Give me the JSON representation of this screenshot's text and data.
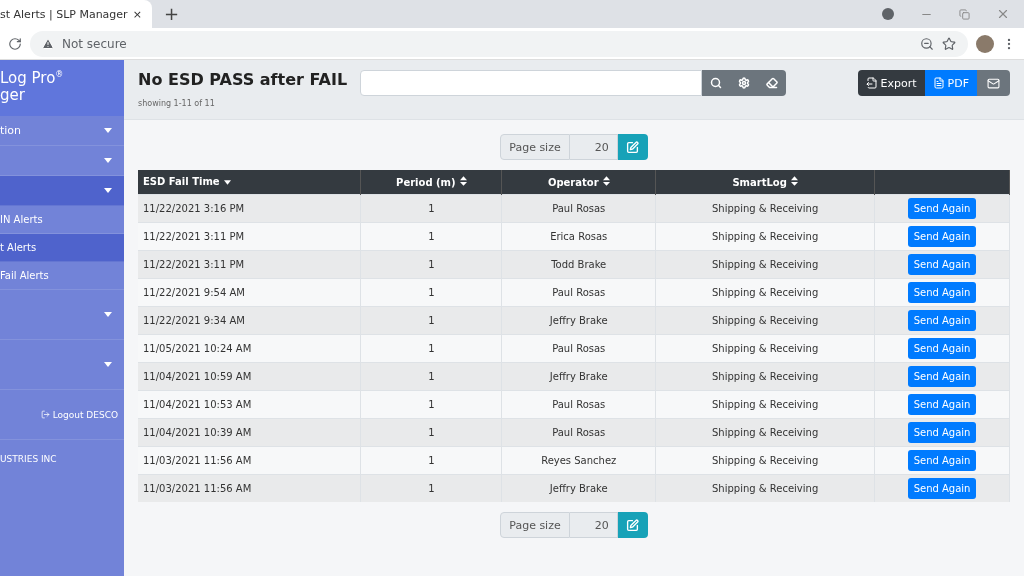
{
  "browser": {
    "tab_title": "st Alerts | SLP Manager",
    "close": "×",
    "new_tab": "+",
    "security": "Not secure"
  },
  "sidebar": {
    "brand": [
      "Log Pro$^{®}$",
      "ger"
    ],
    "items": [
      {
        "kind": "menu",
        "label": "tion",
        "selected": false
      },
      {
        "kind": "menu",
        "selected": false
      },
      {
        "kind": "menu",
        "selected": true
      },
      {
        "kind": "submenu",
        "label": "IN Alerts",
        "selected": false
      },
      {
        "kind": "submenu",
        "label": "t Alerts",
        "selected": true
      },
      {
        "kind": "submenu",
        "label": "Fail Alerts",
        "selected": false
      },
      {
        "kind": "group",
        "selected": false
      },
      {
        "kind": "group",
        "selected": false
      },
      {
        "kind": "logout",
        "label": "Logout DESCO",
        "selected": false
      }
    ],
    "company": "USTRIES INC"
  },
  "header": {
    "title": "No ESD PASS after FAIL",
    "subtitle": "showing 1-11 of 11",
    "export": "Export",
    "pdf": "PDF"
  },
  "pager_top": {
    "label": "Page size",
    "value": "20"
  },
  "table": {
    "columns": [
      {
        "label": "ESD Fail Time",
        "sorted": true
      },
      {
        "label": "Period (m)",
        "sorted": false
      },
      {
        "label": "Operator",
        "sorted": false
      },
      {
        "label": "SmartLog",
        "sorted": false
      }
    ],
    "rows": [
      {
        "time": "11/22/2021 3:16 PM",
        "period": "1",
        "operator": "Paul Rosas",
        "smartlog": "Shipping & Receiving",
        "action": "Send Again"
      },
      {
        "time": "11/22/2021 3:11 PM",
        "period": "1",
        "operator": "Erica Rosas",
        "smartlog": "Shipping & Receiving",
        "action": "Send Again"
      },
      {
        "time": "11/22/2021 3:11 PM",
        "period": "1",
        "operator": "Todd Brake",
        "smartlog": "Shipping & Receiving",
        "action": "Send Again"
      },
      {
        "time": "11/22/2021 9:54 AM",
        "period": "1",
        "operator": "Paul Rosas",
        "smartlog": "Shipping & Receiving",
        "action": "Send Again"
      },
      {
        "time": "11/22/2021 9:34 AM",
        "period": "1",
        "operator": "Jeffry Brake",
        "smartlog": "Shipping & Receiving",
        "action": "Send Again"
      },
      {
        "time": "11/05/2021 10:24 AM",
        "period": "1",
        "operator": "Paul Rosas",
        "smartlog": "Shipping & Receiving",
        "action": "Send Again"
      },
      {
        "time": "11/04/2021 10:59 AM",
        "period": "1",
        "operator": "Jeffry Brake",
        "smartlog": "Shipping & Receiving",
        "action": "Send Again"
      },
      {
        "time": "11/04/2021 10:53 AM",
        "period": "1",
        "operator": "Paul Rosas",
        "smartlog": "Shipping & Receiving",
        "action": "Send Again"
      },
      {
        "time": "11/04/2021 10:39 AM",
        "period": "1",
        "operator": "Paul Rosas",
        "smartlog": "Shipping & Receiving",
        "action": "Send Again"
      },
      {
        "time": "11/03/2021 11:56 AM",
        "period": "1",
        "operator": "Reyes Sanchez",
        "smartlog": "Shipping & Receiving",
        "action": "Send Again"
      },
      {
        "time": "11/03/2021 11:56 AM",
        "period": "1",
        "operator": "Jeffry Brake",
        "smartlog": "Shipping & Receiving",
        "action": "Send Again"
      }
    ]
  },
  "pager_bottom": {
    "label": "Page size",
    "value": "20"
  }
}
